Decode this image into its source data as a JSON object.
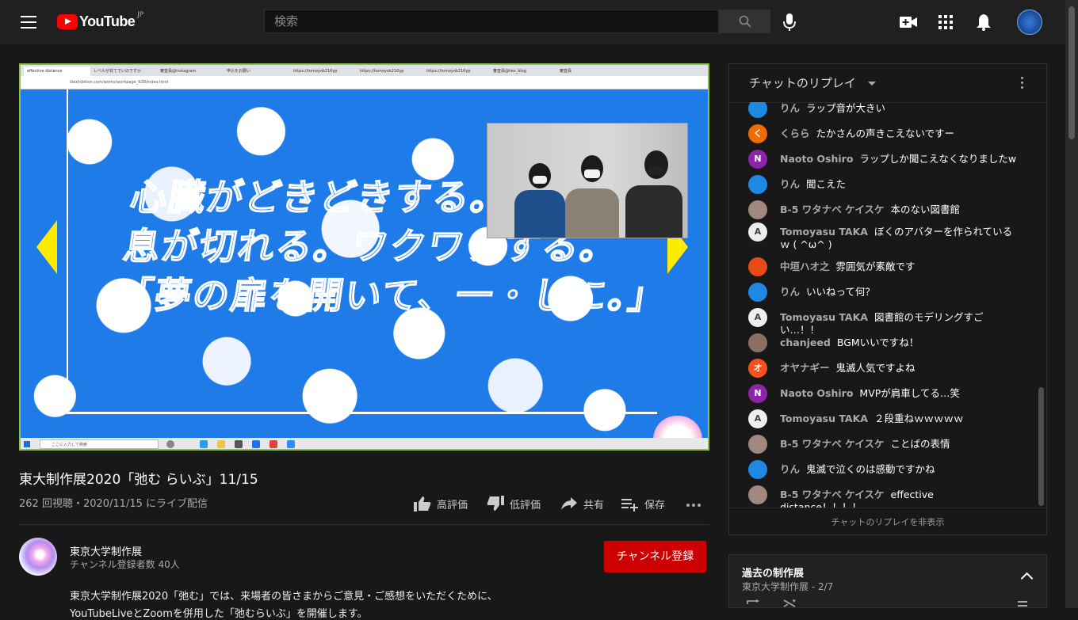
{
  "header": {
    "logo_text": "YouTube",
    "logo_region": "JP",
    "search_placeholder": "検索"
  },
  "video": {
    "title": "東大制作展2020「弛む らいぶ」11/15",
    "views": "262 回視聴・2020/11/15 にライブ配信",
    "actions": {
      "like": "高評価",
      "dislike": "低評価",
      "share": "共有",
      "save": "保存"
    },
    "slide_lines": [
      "心臓がどきどきする。",
      "息が切れる。ワクワクする。",
      "「夢の扉を開いて、一・しに。」"
    ],
    "browser_tabs": [
      "effective distance",
      "レベルが充てでいのですか",
      "審査員@instagram",
      "申込をお願い",
      "https://tomoyok216yp",
      "https://tomoyok216yp",
      "https://tomoyok216yp",
      "審査員@ilex_blog",
      "審査員"
    ],
    "browser_url": "iiiexhibition.com/works/workpage_92B/index.html",
    "taskbar_search": "ここに入力して検索"
  },
  "channel": {
    "name": "東京大学制作展",
    "subscribers": "チャンネル登録者数 40人",
    "subscribe_label": "チャンネル登録",
    "description_line1": "東京大学制作展2020「弛む」では、来場者の皆さまからご意見・ご感想をいただくために、",
    "description_line2": "YouTubeLiveとZoomを併用した「弛むらいぶ」を開催します。"
  },
  "chat": {
    "title": "チャットのリプレイ",
    "hide_label": "チャットのリプレイを非表示",
    "messages": [
      {
        "author": "りん",
        "text": "ラップ音が大きい",
        "avatar": "",
        "avatar_color": "#1e88e5"
      },
      {
        "author": "くらら",
        "text": "たかさんの声きこえないですー",
        "avatar": "く",
        "avatar_color": "#ef6c00"
      },
      {
        "author": "Naoto Oshiro",
        "text": "ラップしか聞こえなくなりましたw",
        "avatar": "N",
        "avatar_color": "#8e24aa"
      },
      {
        "author": "りん",
        "text": "聞こえた",
        "avatar": "",
        "avatar_color": "#1e88e5"
      },
      {
        "author": "B-5 ワタナベ ケイスケ",
        "text": "本のない図書館",
        "avatar": "",
        "avatar_color": "#a1887f"
      },
      {
        "author": "Tomoyasu TAKA",
        "text": "ぼくのアバターを作られているｗ ( ^ω^ )",
        "avatar": "A",
        "avatar_color": "#eeeeee"
      },
      {
        "author": "中垣ハオ之",
        "text": "雰囲気が素敵です",
        "avatar": "",
        "avatar_color": "#e64a19"
      },
      {
        "author": "りん",
        "text": "いいねって何？",
        "avatar": "",
        "avatar_color": "#1e88e5"
      },
      {
        "author": "Tomoyasu TAKA",
        "text": "図書館のモデリングすごい…！！",
        "avatar": "A",
        "avatar_color": "#eeeeee"
      },
      {
        "author": "chanjeed",
        "text": "BGMいいですね！",
        "avatar": "",
        "avatar_color": "#8d6e63"
      },
      {
        "author": "オヤナギー",
        "text": "鬼滅人気ですよね",
        "avatar": "オ",
        "avatar_color": "#f4511e"
      },
      {
        "author": "Naoto Oshiro",
        "text": "MVPが肩車してる…笑",
        "avatar": "N",
        "avatar_color": "#8e24aa"
      },
      {
        "author": "Tomoyasu TAKA",
        "text": "２段重ねｗｗｗｗｗ",
        "avatar": "A",
        "avatar_color": "#eeeeee"
      },
      {
        "author": "B-5 ワタナベ ケイスケ",
        "text": "ことばの表情",
        "avatar": "",
        "avatar_color": "#a1887f"
      },
      {
        "author": "りん",
        "text": "鬼滅で泣くのは感動ですかね",
        "avatar": "",
        "avatar_color": "#1e88e5"
      },
      {
        "author": "B-5 ワタナベ ケイスケ",
        "text": "effective distance！！！！",
        "avatar": "",
        "avatar_color": "#a1887f"
      }
    ]
  },
  "playlist": {
    "title": "過去の制作展",
    "subtitle": "東京大学制作展 - 2/7"
  },
  "colors": {
    "background": "#181818",
    "topbar": "#202020",
    "subscribe": "#cc0000",
    "brand_red": "#ff0000",
    "player_border": "#8bc34a",
    "slide_arrow": "#ffeb00"
  }
}
